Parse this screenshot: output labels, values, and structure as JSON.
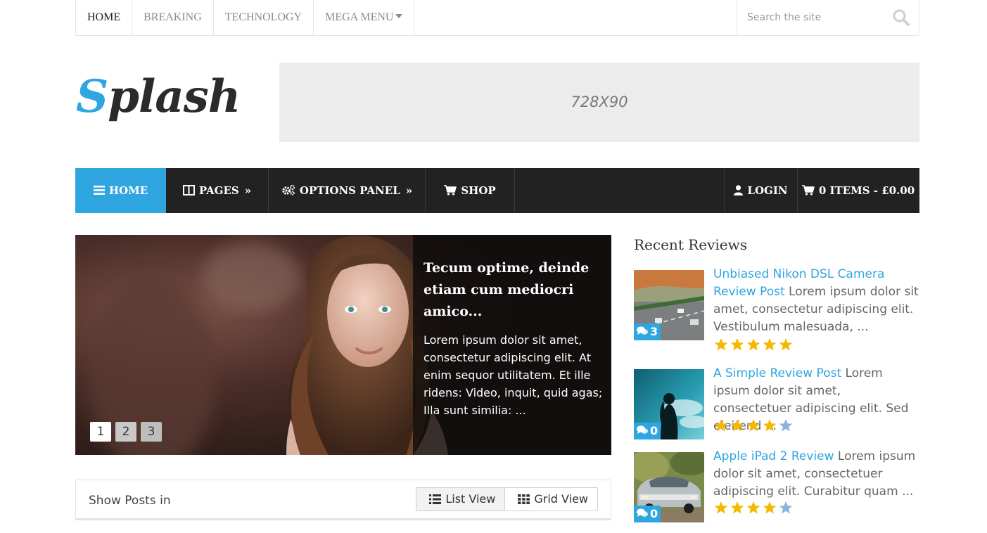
{
  "topnav": {
    "items": [
      "HOME",
      "BREAKING",
      "TECHNOLOGY",
      "MEGA MENU"
    ]
  },
  "search": {
    "placeholder": "Search the site"
  },
  "logo": {
    "first": "S",
    "rest": "plash"
  },
  "ad": {
    "label": "728X90"
  },
  "mainnav": {
    "home": "HOME",
    "pages": "PAGES",
    "options": "OPTIONS PANEL",
    "shop": "SHOP",
    "login": "LOGIN",
    "cart": "0 ITEMS - £0.00",
    "raquo": "»"
  },
  "slider": {
    "title": "Tecum optime, deinde etiam cum mediocri amico...",
    "excerpt": "Lorem ipsum dolor sit amet, consectetur adipiscing elit. At enim sequor utilitatem. Et ille ridens: Video, inquit, quid agas; Illa sunt similia: ...",
    "pager": [
      "1",
      "2",
      "3"
    ]
  },
  "viewbar": {
    "label": "Show Posts in",
    "list": "List View",
    "grid": "Grid View"
  },
  "sidebar": {
    "title": "Recent Reviews",
    "reviews": [
      {
        "title": "Unbiased Nikon DSL Camera Review Post",
        "excerpt": " Lorem ipsum dolor sit amet, consectetur adipiscing elit. Vestibulum malesuada, ...",
        "comments": "3",
        "rating": 5
      },
      {
        "title": "A Simple Review Post",
        "excerpt": " Lorem ipsum dolor sit amet, consectetuer adipiscing elit. Sed eleifend ...",
        "comments": "0",
        "rating": 4
      },
      {
        "title": "Apple iPad 2 Review",
        "excerpt": " Lorem ipsum dolor sit amet, consectetuer adipiscing elit. Curabitur quam ...",
        "comments": "0",
        "rating": 4
      }
    ]
  },
  "colors": {
    "accent": "#2fa6e0",
    "nav_bg": "#222222",
    "star_on": "#f5b800",
    "star_off": "#8ab4dc"
  }
}
